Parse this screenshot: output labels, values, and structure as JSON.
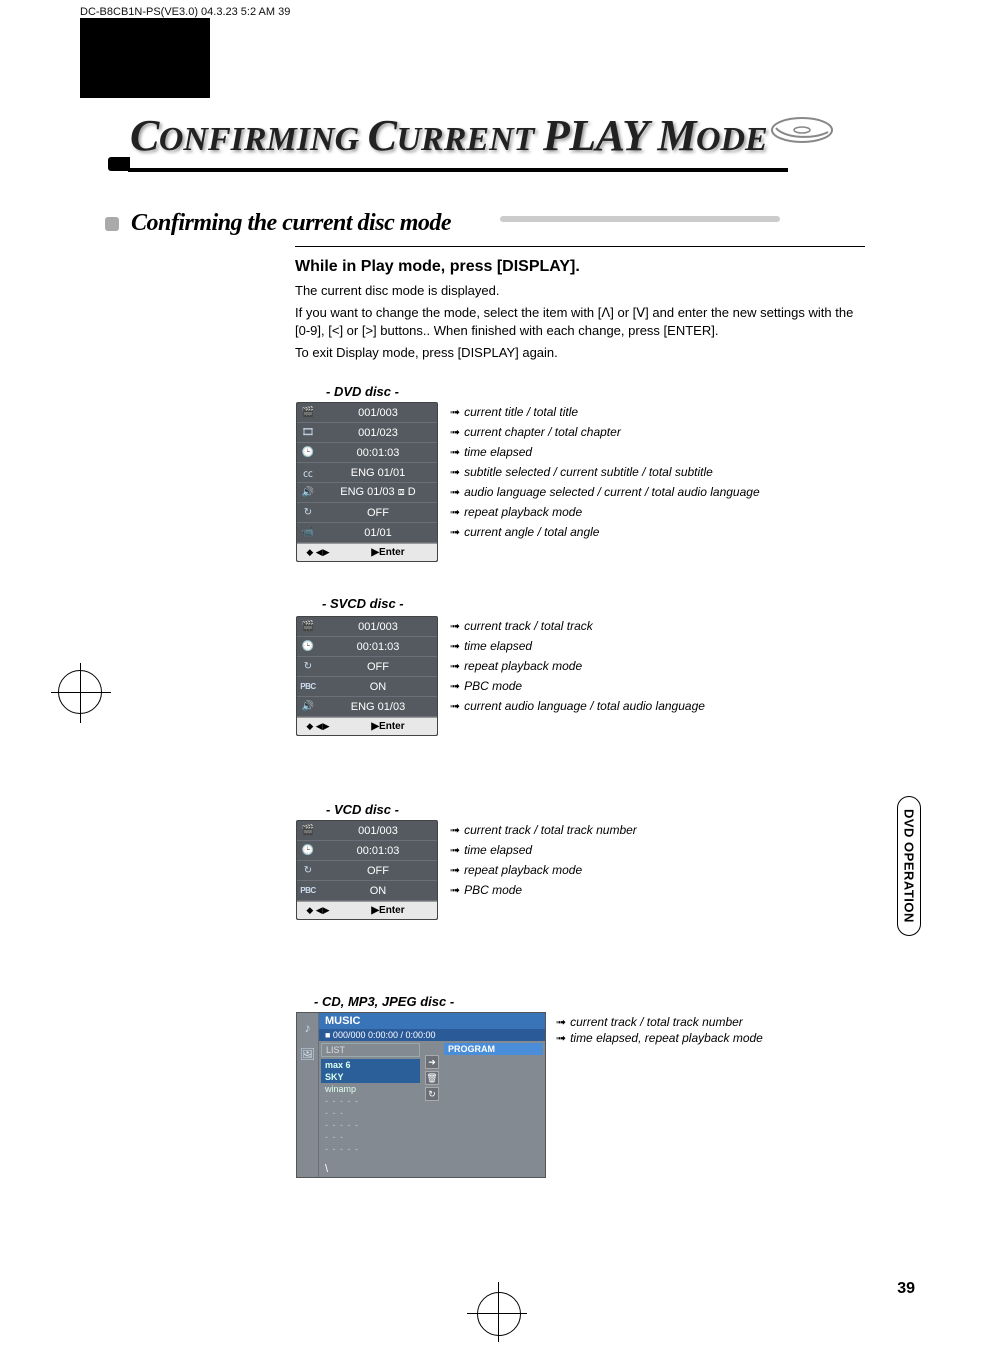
{
  "header_bar": "DC-B8CB1N-PS(VE3.0)  04.3.23 5:2 AM      39",
  "page_title_parts": {
    "p1": "C",
    "p2": "ONFIRMING ",
    "p3": "C",
    "p4": "URRENT ",
    "p5": "PLAY M",
    "p6": "ODE"
  },
  "section_title": "Confirming the current  disc mode",
  "intro": {
    "heading": "While in Play mode, press [DISPLAY].",
    "line1": "The current disc mode is displayed.",
    "line2": "If you want to change the mode, select the item with [ᐱ] or [ᐯ] and enter the new settings with the [0-9], [<] or [>] buttons.. When finished with each change, press [ENTER].",
    "line3": "To exit Display mode, press [DISPLAY] again."
  },
  "labels": {
    "dvd": "- DVD disc -",
    "svcd": "- SVCD disc -",
    "vcd": "- VCD disc -",
    "cd": "- CD, MP3, JPEG disc -"
  },
  "footer_nav": "◆ ◀▶",
  "footer_enter": "▶Enter",
  "dvd": {
    "rows": [
      {
        "val": "001/003",
        "desc": "current title / total title"
      },
      {
        "val": "001/023",
        "desc": "current chapter / total chapter"
      },
      {
        "val": "00:01:03",
        "desc": "time elapsed"
      },
      {
        "val": "ENG 01/01",
        "desc": "subtitle selected / current subtitle / total subtitle"
      },
      {
        "val": "ENG 01/03 ⧈ D",
        "desc": "audio language selected / current  / total audio language"
      },
      {
        "val": "OFF",
        "desc": "repeat playback mode"
      },
      {
        "val": "01/01",
        "desc": "current angle  / total angle"
      }
    ]
  },
  "svcd": {
    "rows": [
      {
        "val": "001/003",
        "desc": "current track  / total track"
      },
      {
        "val": "00:01:03",
        "desc": "time elapsed"
      },
      {
        "val": "OFF",
        "desc": "repeat playback mode"
      },
      {
        "val": "ON",
        "desc": "PBC mode"
      },
      {
        "val": "ENG 01/03",
        "desc": "current audio language / total audio language"
      }
    ]
  },
  "vcd": {
    "rows": [
      {
        "val": "001/003",
        "desc": "current track  / total track number"
      },
      {
        "val": "00:01:03",
        "desc": "time elapsed"
      },
      {
        "val": "OFF",
        "desc": "repeat playback mode"
      },
      {
        "val": "ON",
        "desc": "PBC mode"
      }
    ]
  },
  "cd": {
    "desc1": "current track  / total track number",
    "desc2": "time elapsed, repeat playback mode"
  },
  "music_box": {
    "title": "MUSIC",
    "status": "■ 000/000 0:00:00 / 0:00:00",
    "list_label": "LIST",
    "program_label": "PROGRAM",
    "items": [
      {
        "txt": "max 6",
        "cls": "hl"
      },
      {
        "txt": "SKY",
        "cls": "hl"
      },
      {
        "txt": "winamp",
        "cls": ""
      },
      {
        "txt": "- - - - -",
        "cls": "dim"
      },
      {
        "txt": "- - -",
        "cls": "dim"
      },
      {
        "txt": "- - - - -",
        "cls": "dim"
      },
      {
        "txt": "- - -",
        "cls": "dim"
      },
      {
        "txt": "- - - - -",
        "cls": "dim"
      }
    ],
    "foot_slash": "\\"
  },
  "side_tab": "DVD OPERATION",
  "page_num": "39"
}
